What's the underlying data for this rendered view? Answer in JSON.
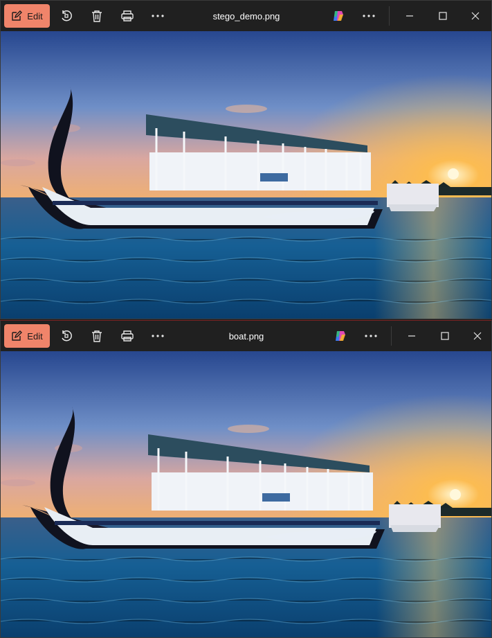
{
  "windows": [
    {
      "title": "stego_demo.png",
      "edit_label": "Edit"
    },
    {
      "title": "boat.png",
      "edit_label": "Edit"
    }
  ],
  "toolbar_icons": [
    "edit-icon",
    "rotate-icon",
    "trash-icon",
    "print-icon",
    "more-icon",
    "copilot-icon",
    "more-icon",
    "minimize-icon",
    "maximize-icon",
    "close-icon"
  ],
  "colors": {
    "accent": "#f0846a",
    "titlebar": "#202020",
    "sky_top": "#2a4fa0",
    "sunset": "#f5a23a",
    "water": "#1b6f9e"
  }
}
